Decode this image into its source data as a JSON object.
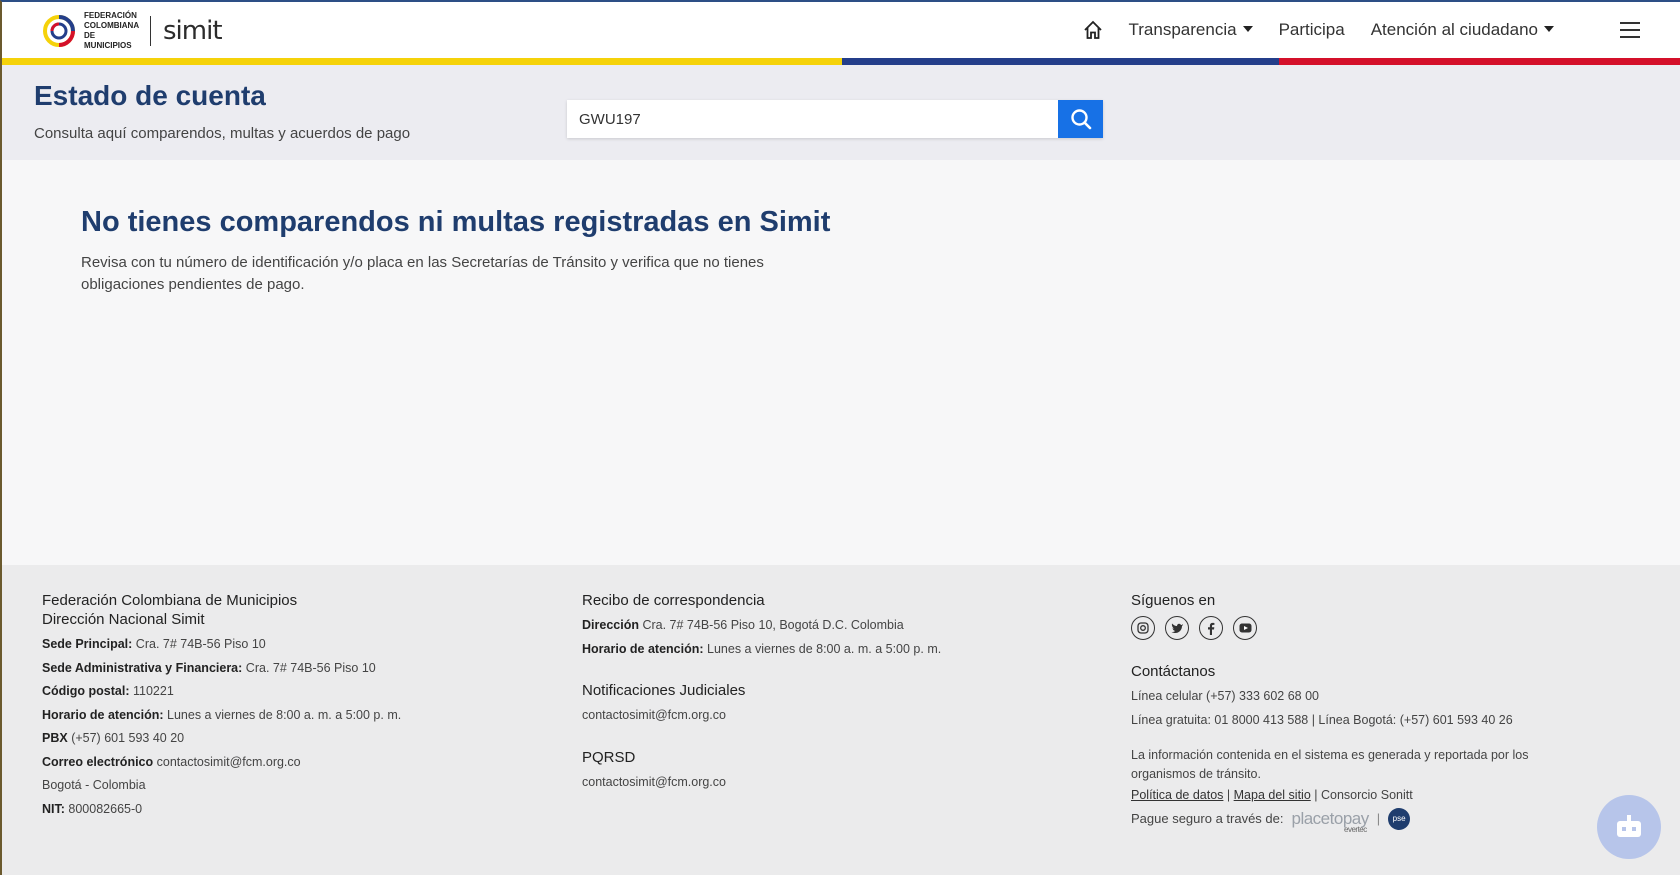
{
  "header": {
    "logo_lines": [
      "Federación",
      "Colombiana",
      "de Municipios"
    ],
    "logo_brand": "simit",
    "nav": [
      {
        "label": "Transparencia",
        "dropdown": true
      },
      {
        "label": "Participa",
        "dropdown": false
      },
      {
        "label": "Atención al ciudadano",
        "dropdown": true
      }
    ],
    "stripe_colors": [
      "#f5d20a",
      "#243e8a",
      "#d4102a"
    ]
  },
  "subheader": {
    "title": "Estado de cuenta",
    "subtitle": "Consulta aquí comparendos, multas y acuerdos de pago",
    "search_value": "GWU197"
  },
  "main": {
    "heading": "No tienes comparendos ni multas registradas en Simit",
    "body": "Revisa con tu número de identificación y/o placa en las Secretarías de Tránsito y verifica que no tienes obligaciones pendientes de pago."
  },
  "footer": {
    "col1": {
      "title1": "Federación Colombiana de Municipios",
      "title2": "Dirección Nacional Simit",
      "rows": [
        {
          "label": "Sede Principal:",
          "value": "Cra. 7# 74B-56 Piso 10"
        },
        {
          "label": "Sede Administrativa y Financiera:",
          "value": "Cra. 7# 74B-56 Piso 10"
        },
        {
          "label": "Código postal:",
          "value": "110221"
        },
        {
          "label": "Horario de atención:",
          "value": "Lunes a viernes de 8:00 a. m. a 5:00 p. m."
        },
        {
          "label": "PBX",
          "value": "(+57) 601 593 40 20"
        },
        {
          "label": "Correo electrónico",
          "value": "contactosimit@fcm.org.co"
        },
        {
          "label": "",
          "value": "Bogotá - Colombia"
        },
        {
          "label": "NIT:",
          "value": "800082665-0"
        }
      ]
    },
    "col2": {
      "title": "Recibo de correspondencia",
      "rows": [
        {
          "label": "Dirección",
          "value": "Cra. 7# 74B-56 Piso 10, Bogotá D.C. Colombia"
        },
        {
          "label": "Horario de atención:",
          "value": "Lunes a viernes de 8:00 a. m. a 5:00 p. m."
        }
      ],
      "judicial_title": "Notificaciones Judiciales",
      "judicial_email": "contactosimit@fcm.org.co",
      "pqrsd_title": "PQRSD",
      "pqrsd_email": "contactosimit@fcm.org.co"
    },
    "col3": {
      "follow_title": "Síguenos en",
      "social_icons": [
        "instagram-icon",
        "twitter-icon",
        "facebook-icon",
        "youtube-icon"
      ],
      "contact_title": "Contáctanos",
      "phone_mobile": "Línea celular (+57) 333 602 68 00",
      "phone_free": "Línea gratuita: 01 8000 413 588 | Línea Bogotá: (+57) 601 593 40 26",
      "disclaimer": "La información contenida en el sistema es generada y reportada por los organismos de tránsito.",
      "link_policy": "Política de datos",
      "link_map": "Mapa del sitio",
      "consortium": "Consorcio Sonitt",
      "pay_label": "Pague seguro a través de:",
      "pay_brand": "placetopay",
      "pay_brand_sub": "evertec",
      "pse_label": "pse"
    }
  }
}
